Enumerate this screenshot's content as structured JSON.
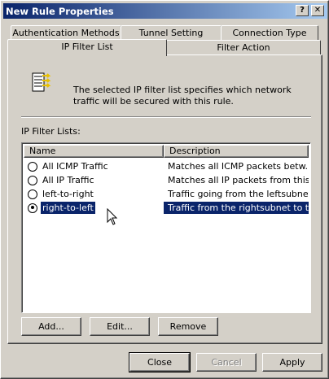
{
  "window": {
    "title": "New Rule Properties",
    "help_button": "?",
    "close_button": "✕"
  },
  "tabs": {
    "back_row": [
      "Authentication Methods",
      "Tunnel Setting",
      "Connection Type"
    ],
    "front_row": [
      "IP Filter List",
      "Filter Action"
    ],
    "active": "IP Filter List"
  },
  "panel": {
    "description": "The selected IP filter list specifies which network traffic will be secured with this rule.",
    "lists_label": "IP Filter Lists:",
    "columns": [
      "Name",
      "Description"
    ],
    "rows": [
      {
        "name": "All ICMP Traffic",
        "description": "Matches all ICMP packets betw...",
        "selected": false
      },
      {
        "name": "All IP Traffic",
        "description": "Matches all IP packets from this ...",
        "selected": false
      },
      {
        "name": "left-to-right",
        "description": "Traffic going from the leftsubnet ...",
        "selected": false
      },
      {
        "name": "right-to-left",
        "description": "Traffic from the rightsubnet to th...",
        "selected": true
      }
    ],
    "add_button": "Add...",
    "edit_button": "Edit...",
    "remove_button": "Remove"
  },
  "footer": {
    "close_button": "Close",
    "cancel_button": "Cancel",
    "apply_button": "Apply"
  },
  "colors": {
    "title_bar": "#0a246a",
    "selection": "#0a246a",
    "face": "#d4d0c8"
  }
}
